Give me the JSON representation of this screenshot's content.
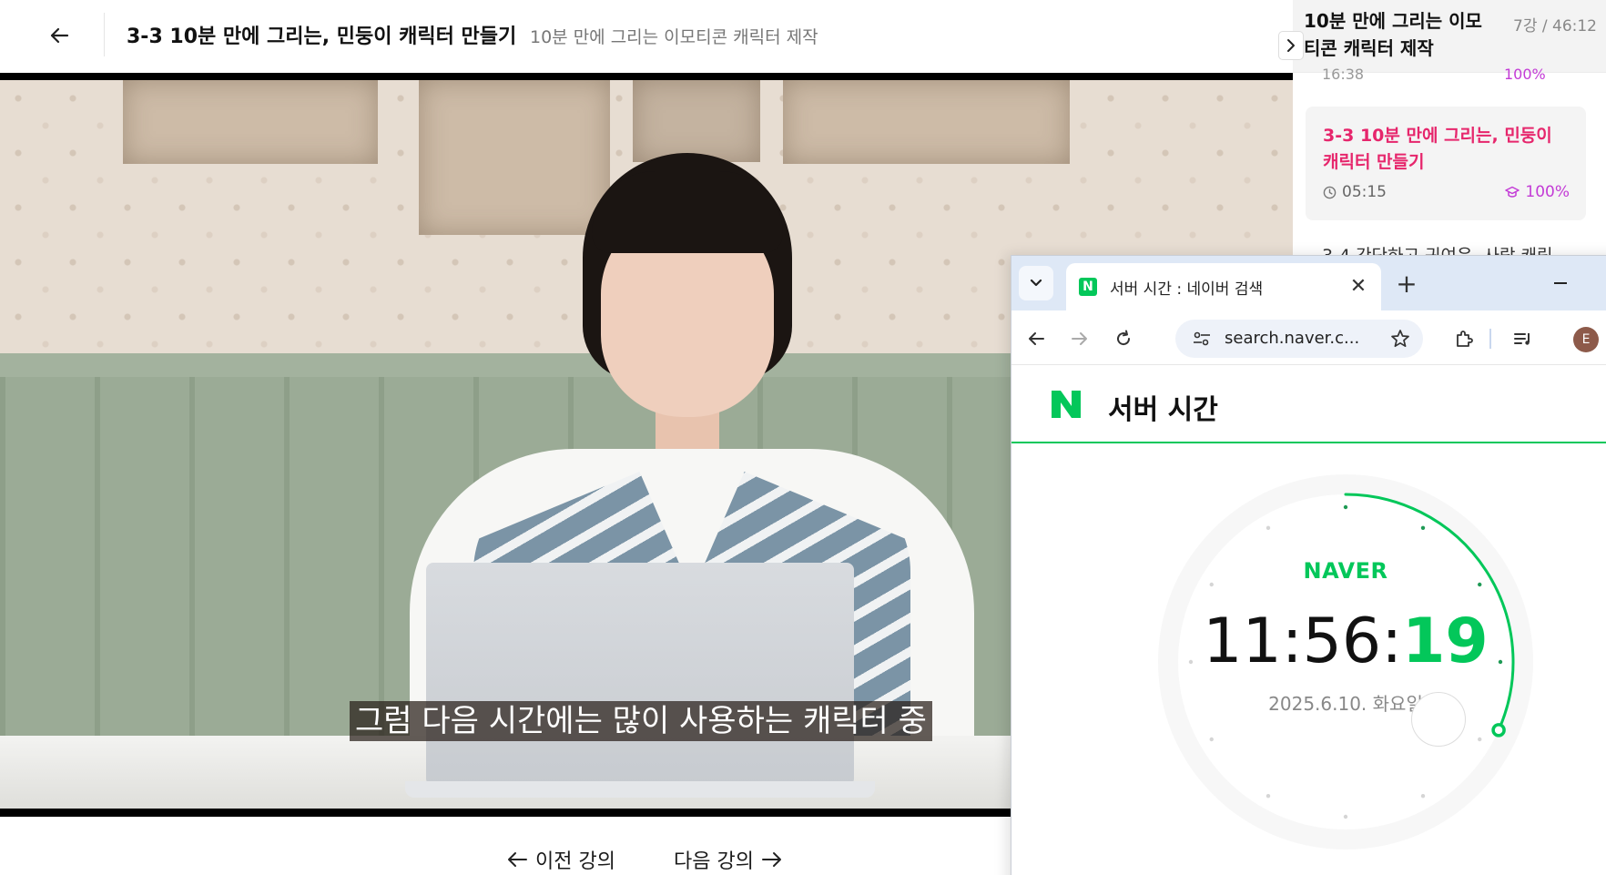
{
  "header": {
    "lecture_title": "3-3 10분 만에 그리는, 민둥이 캐릭터 만들기",
    "course_subtitle": "10분 만에 그리는 이모티콘 캐릭터 제작"
  },
  "video": {
    "caption": "그럼 다음 시간에는 많이 사용하는 캐릭터 중"
  },
  "lesson_nav": {
    "prev_label": "이전 강의",
    "next_label": "다음 강의"
  },
  "curriculum": {
    "course_title": "10분 만에 그리는 이모티콘 캐릭터 제작",
    "lesson_count": "7강 / 46:12",
    "prev_item_duration": "16:38",
    "prev_item_progress": "100%",
    "current_item": {
      "title": "3-3 10분 만에 그리는, 민둥이 캐릭터 만들기",
      "duration": "05:15",
      "progress": "100%"
    },
    "next_item_peek": "3-4 간단하고 귀여운, 사람 캐릭"
  },
  "browser": {
    "tab_title": "서버 시간 : 네이버 검색",
    "address": "search.naver.c...",
    "avatar_letter": "E",
    "new_tab_glyph": "+",
    "close_glyph": "✕"
  },
  "naver_widget": {
    "title": "서버 시간",
    "brand": "NAVER",
    "time_hm": "11:56:",
    "time_s": "19",
    "date": "2025.6.10. 화요일",
    "seconds_progress": 0.3167
  },
  "colors": {
    "accent_pink": "#e6266c",
    "progress_purple": "#c33bd6",
    "naver_green": "#03c75a"
  }
}
